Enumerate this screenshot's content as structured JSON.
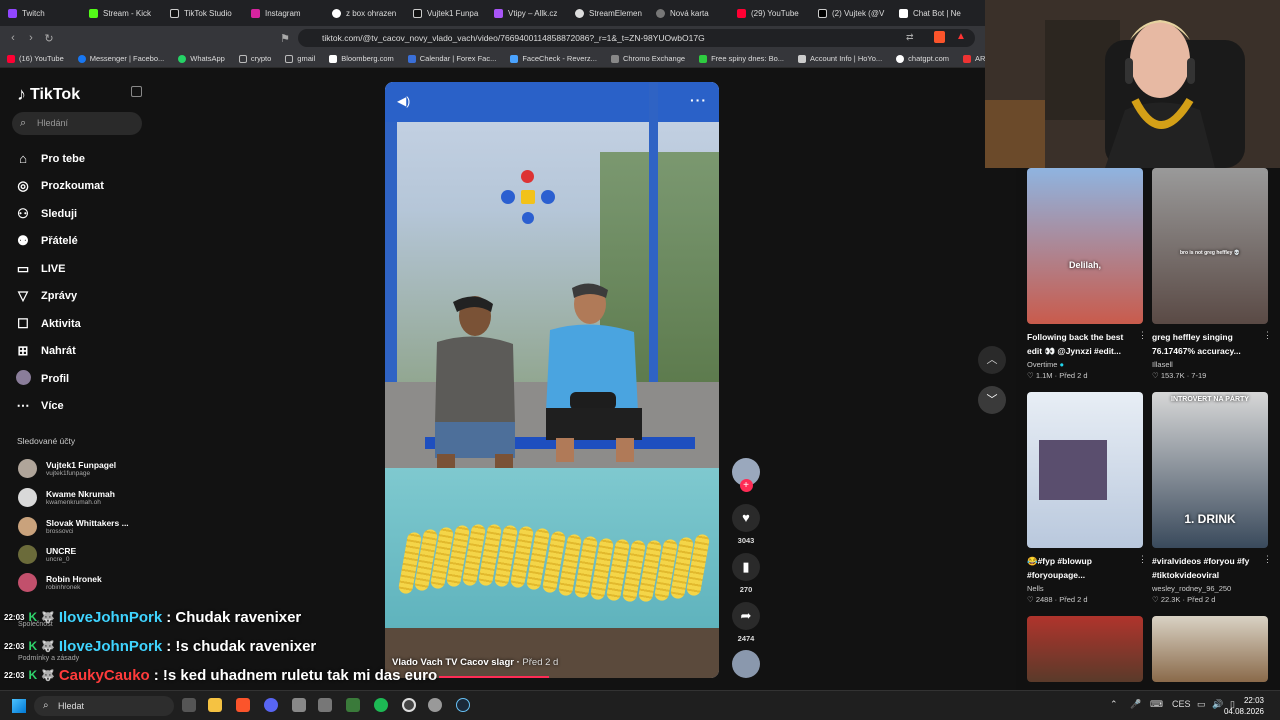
{
  "browser": {
    "tabs": [
      "Twitch",
      "Stream - Kick",
      "TikTok Studio",
      "Instagram",
      "z box ohrazen",
      "Vujtek1 Funpa",
      "Vtipy – Allk.cz",
      "StreamElemen",
      "Nová karta",
      "(29) YouTube",
      "(2) Vujtek (@V",
      "Chat Bot | Ne"
    ],
    "url": "tiktok.com/@tv_cacov_novy_vlado_vach/video/7669400114858872086?_r=1&_t=ZN-98YUOwbO17G",
    "bookmarks": [
      "(16) YouTube",
      "Messenger | Facebo...",
      "WhatsApp",
      "crypto",
      "gmail",
      "Bloomberg.com",
      "Calendar | Forex Fac...",
      "FaceCheck - Reverz...",
      "Chromo Exchange",
      "Free spiny dnes: Bo...",
      "Account Info | HoYo...",
      "chatgpt.com",
      "ARC Raiders"
    ]
  },
  "tiktok": {
    "logo": "TikTok",
    "search_placeholder": "Hledání",
    "nav": [
      "Pro tebe",
      "Prozkoumat",
      "Sleduji",
      "Přátelé",
      "LIVE",
      "Zprávy",
      "Aktivita",
      "Nahrát",
      "Profil",
      "Více"
    ],
    "followed_title": "Sledované účty",
    "followed": [
      {
        "name": "Vujtek1 Funpagel",
        "handle": "vujtek1funpage"
      },
      {
        "name": "Kwame Nkrumah",
        "handle": "kwamenkrumah.oh"
      },
      {
        "name": "Slovak Whittakers ...",
        "handle": "brossovci"
      },
      {
        "name": "UNCRE",
        "handle": "uncre_0"
      },
      {
        "name": "Robin Hronek",
        "handle": "robinhronek"
      }
    ],
    "video": {
      "author": "Vlado Vach TV Cacov slagr",
      "time": "Před 2 d",
      "likes": "3043",
      "saves": "270",
      "shares": "2474"
    },
    "recommended": [
      {
        "title": "Following back the best edit 👀 @Jynxzi #edit...",
        "author": "Overtime",
        "views": "1.1M",
        "date": "Před 2 d",
        "overlay": "Delilah,"
      },
      {
        "title": "greg heffley singing 76.17467% accuracy...",
        "author": "Illasell",
        "views": "153.7K",
        "date": "7-19",
        "overlay": "bro is not greg heffley 💀"
      },
      {
        "title": "😂#fyp #blowup #foryoupage...",
        "author": "Nells",
        "views": "2488",
        "date": "Před 2 d",
        "overlay": ""
      },
      {
        "title": "#viralvideos #foryou #fy #tiktokvideoviral",
        "author": "wesley_rodney_96_250",
        "views": "22.3K",
        "date": "Před 2 d",
        "overlay": "1. DRINK",
        "overlay_top": "INTROVERT NA PÁRTY"
      }
    ]
  },
  "chat": [
    {
      "time": "22:03",
      "user": "IloveJohnPork",
      "color": "#3fd4ff",
      "message": ": Chudak ravenixer"
    },
    {
      "time": "22:03",
      "user": "IloveJohnPork",
      "color": "#3fd4ff",
      "message": ": !s chudak ravenixer"
    },
    {
      "time": "22:03",
      "user": "CaukyCauko",
      "color": "#ff3b3b",
      "message": ": !s ked uhadnem ruletu tak mi das euro"
    }
  ],
  "ghost_text": [
    "Společnost",
    "Podmínky a zásady"
  ],
  "taskbar": {
    "search": "Hledat",
    "lang": "CES",
    "time": "22:03",
    "date": "04.08.2026"
  }
}
